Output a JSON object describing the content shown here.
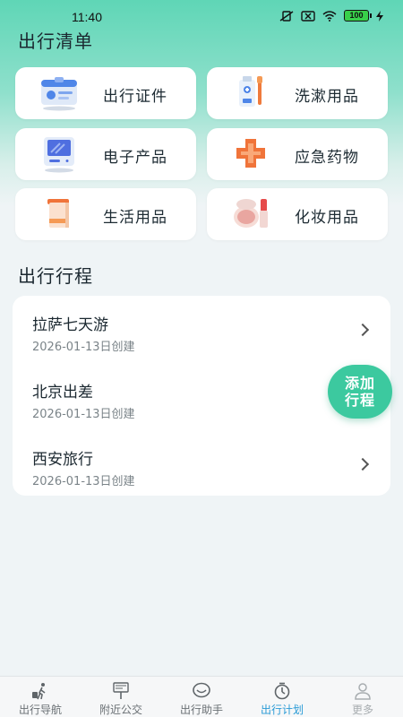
{
  "status_bar": {
    "time": "11:40",
    "battery": "100"
  },
  "checklist": {
    "title": "出行清单",
    "categories": [
      {
        "label": "出行证件",
        "icon": "id-card-icon"
      },
      {
        "label": "洗漱用品",
        "icon": "toiletries-icon"
      },
      {
        "label": "电子产品",
        "icon": "tablet-icon"
      },
      {
        "label": "应急药物",
        "icon": "first-aid-icon"
      },
      {
        "label": "生活用品",
        "icon": "towel-icon"
      },
      {
        "label": "化妆用品",
        "icon": "cosmetics-icon"
      }
    ]
  },
  "trips": {
    "title": "出行行程",
    "items": [
      {
        "name": "拉萨七天游",
        "date": "2026-01-13日创建"
      },
      {
        "name": "北京出差",
        "date": "2026-01-13日创建"
      },
      {
        "name": "西安旅行",
        "date": "2026-01-13日创建"
      }
    ]
  },
  "fab": {
    "line1": "添加",
    "line2": "行程"
  },
  "tab_bar": {
    "tabs": [
      {
        "label": "出行导航",
        "icon": "walking-traveler-icon"
      },
      {
        "label": "附近公交",
        "icon": "bus-stop-icon"
      },
      {
        "label": "出行助手",
        "icon": "chat-icon"
      },
      {
        "label": "出行计划",
        "icon": "timer-icon"
      },
      {
        "label": "更多",
        "icon": "user-icon"
      }
    ],
    "active_index": 3
  },
  "colors": {
    "accent": "#3cc99f",
    "active_tab": "#2a9bd6"
  }
}
